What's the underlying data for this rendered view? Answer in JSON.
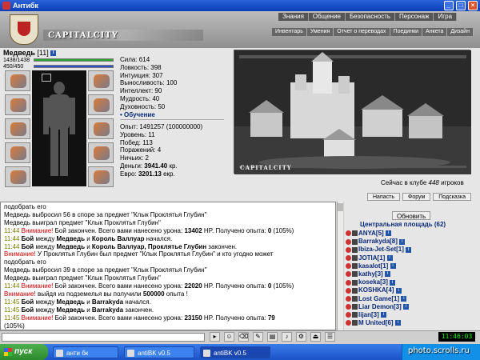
{
  "window": {
    "title": "Антибк"
  },
  "menu_top": [
    "Знания",
    "Общение",
    "Безопасность",
    "Персонаж",
    "Игра"
  ],
  "menu_sub": [
    "Инвентарь",
    "Умения",
    "Отчет о переводах",
    "Поединки",
    "Анкета",
    "Дизайн"
  ],
  "logo": "CAPITALCITY",
  "character": {
    "name": "Медведь",
    "level": "[11]",
    "hp": "1438/1438",
    "hp_fraction": 1.0,
    "mp": "450/450",
    "mp_fraction": 1.0,
    "stats": [
      "Сила: 614",
      "Ловкость: 398",
      "Интуиция: 307",
      "Выносливость: 100",
      "Интеллект: 90",
      "Мудрость: 40",
      "Духовность: 50"
    ],
    "training_link": "• Обучение",
    "stats2": [
      "Опыт: 1491257 (100000000)",
      "Уровень: 11",
      "Побед: 113",
      "Поражений: 4",
      "Ничьих: 2"
    ],
    "money_label": "Деньги:",
    "money_value": "3941.40",
    "money_unit": "кр.",
    "euro_label": "Евро:",
    "euro_value": "3201.13",
    "euro_unit": "екр."
  },
  "scene": {
    "logo": "CAPITALCITY",
    "players_prefix": "Сейчас в клубе",
    "players_count": "448",
    "players_suffix": "игроков"
  },
  "scene_buttons": [
    "Напасть",
    "Форум",
    "Подсказка"
  ],
  "chat": [
    {
      "text": "подобрать его"
    },
    {
      "text": "Медведь выбросил 56 в споре за предмет \"Клык Проклятья Глубин\""
    },
    {
      "text": "Медведь выиграл предмет \"Клык Проклятья Глубин\""
    },
    {
      "time": "11:44",
      "warn": "Внимание!",
      "text": " Бой закончен. Всего вами нанесено урона: ",
      "bold": "13402",
      "tail": " HP. Получено опыта: ",
      "bold2": "0",
      "tail2": " (105%)"
    },
    {
      "time": "11:44",
      "bold_pre": "Бой",
      "text": " между ",
      "b1": "Медведь",
      "mid": " и ",
      "b2": "Король Валлуар",
      "tail": " начался."
    },
    {
      "time": "11:44",
      "bold_pre": "Бой",
      "text": " между ",
      "b1": "Медведь",
      "mid": " и ",
      "b2": "Король Валлуар, Проклятье Глубин",
      "tail": " закончен."
    },
    {
      "warn_only": "Внимание!",
      "text": " У Проклятья Глубин был предмет \"Клык Проклятья Глубин\" и кто угодно может"
    },
    {
      "text": "подобрать его"
    },
    {
      "text": "Медведь выбросил 39 в споре за предмет \"Клык Проклятья Глубин\""
    },
    {
      "text": "Медведь выиграл предмет \"Клык Проклятья Глубин\""
    },
    {
      "time": "11:44",
      "warn": "Внимание!",
      "text": " Бой закончен. Всего вами нанесено урона: ",
      "bold": "22020",
      "tail": " HP. Получено опыта: ",
      "bold2": "0",
      "tail2": " (105%)"
    },
    {
      "warn_only": "Внимание!",
      "text": " выйдя из подземелья вы получили ",
      "bold": "500000",
      "tail": " опыта !"
    },
    {
      "time": "11:45",
      "bold_pre": "Бой",
      "text": " между ",
      "b1": "Медведь",
      "mid": " и ",
      "b2": "Barrakyda",
      "tail": " начался."
    },
    {
      "time": "11:45",
      "bold_pre": "Бой",
      "text": " между ",
      "b1": "Медведь",
      "mid": " и ",
      "b2": "Barrakyda",
      "tail": " закончен."
    },
    {
      "time": "11:45",
      "warn": "Внимание!",
      "text": " Бой закончен. Всего вами нанесено урона: ",
      "bold": "23150",
      "tail": " HP. Получено опыта: ",
      "bold2": "79",
      "tail2": ""
    },
    {
      "text": "(105%)"
    }
  ],
  "right_panel": {
    "refresh": "Обновить",
    "area_title": "Центральная площадь (62)",
    "players": [
      "ANYA[5]",
      "Barrakyda[8]",
      "Ibiza-Jet-Set[1]",
      "JOTIA[1]",
      "kasalot[1]",
      "kathy[3]",
      "koseka[3]",
      "KOSHKA[4]",
      "Lost Game[1]",
      "Liar Demon[3]",
      "lijan[3]",
      "M United[6]"
    ]
  },
  "clock": "11:46:03",
  "taskbar": {
    "start": "пуск",
    "tasks": [
      "анти бк",
      "antiBK v0.5",
      "antiBK v0.5"
    ],
    "watermark": "photo.scrolls.ru"
  },
  "colors": {
    "hp": "#2aa52a",
    "mp": "#2f4fcf",
    "warn": "#cc0000",
    "time": "#7a7a00",
    "link": "#0a2a7a"
  }
}
